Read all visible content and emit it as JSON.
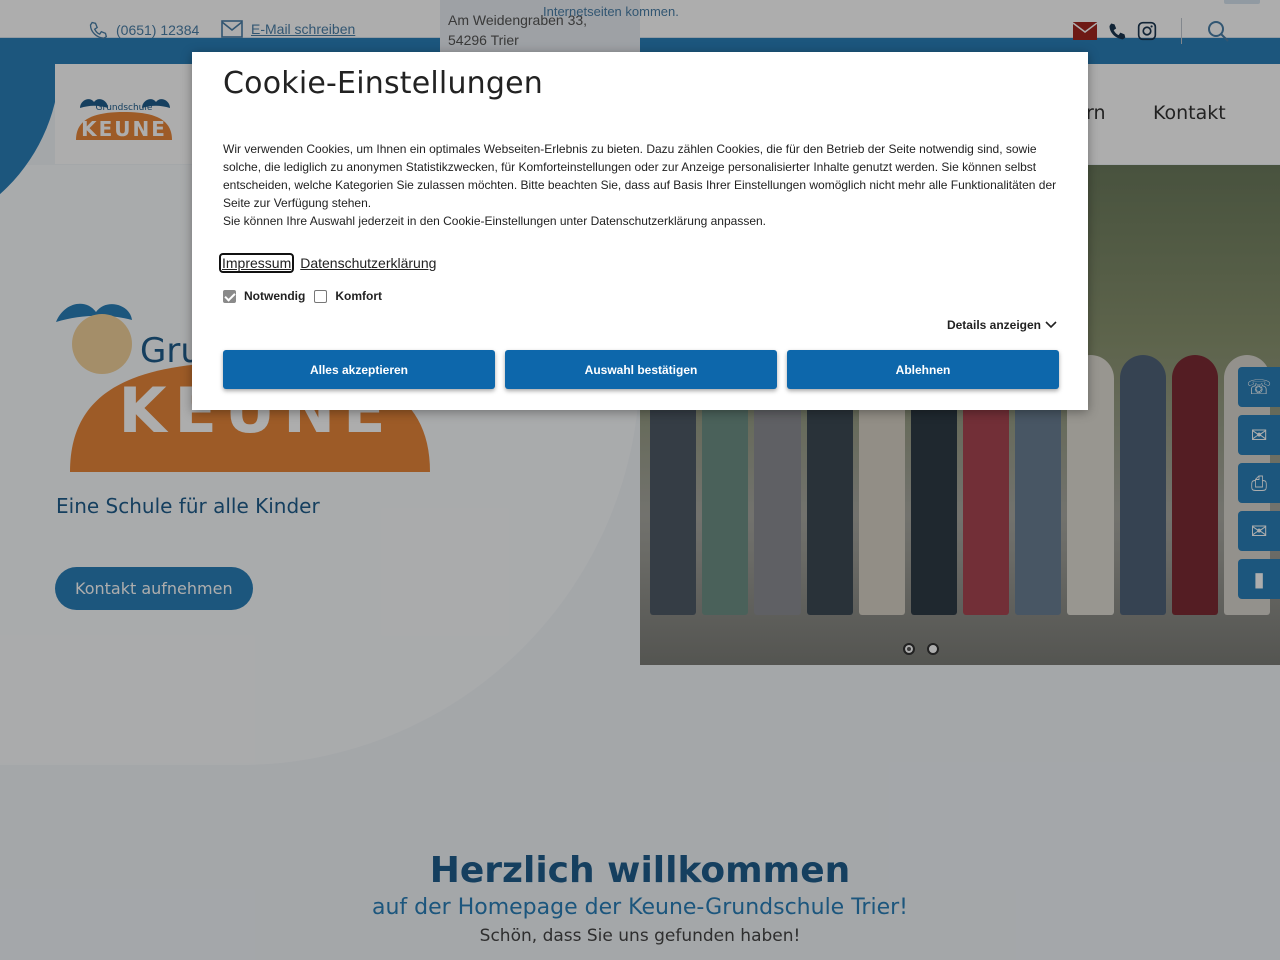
{
  "colors": {
    "accent": "#2a7fb8",
    "dark_blue": "#1f5d8c",
    "button_blue": "#0d67ab",
    "orange": "#e8873a",
    "overlay": "rgba(0,0,0,0.32)"
  },
  "topbar": {
    "phone": "(0651) 12384",
    "email_link": "E-Mail schreiben",
    "address_line1": "Am Weidengraben 33,",
    "address_line2": "54296 Trier",
    "notice_fragment": "Internetseiten kommen.",
    "icons": [
      "mail-icon",
      "phone-icon",
      "instagram-icon",
      "search-icon"
    ]
  },
  "logo": {
    "small_text": "Grundschule",
    "name": "KEUNE"
  },
  "nav": {
    "items": [
      "rn",
      "Kontakt"
    ]
  },
  "hero": {
    "logo_partial": "Gru",
    "logo_name": "KEUNE",
    "tagline": "Eine Schule für alle Kinder",
    "cta": "Kontakt aufnehmen",
    "slider_dots": 2,
    "active_dot": 1
  },
  "side_tools": [
    "contact-card-icon",
    "mail-card-icon",
    "printer-icon",
    "envelope-icon",
    "bookmark-icon"
  ],
  "welcome": {
    "title": "Herzlich willkommen",
    "subtitle": "auf der Homepage der Keune-Grundschule Trier!",
    "small": "Schön, dass Sie uns gefunden haben!"
  },
  "cookie_dialog": {
    "title": "Cookie-Einstellungen",
    "text_paragraph1": "Wir verwenden Cookies, um Ihnen ein optimales Webseiten-Erlebnis zu bieten. Dazu zählen Cookies, die für den Betrieb der Seite notwendig sind, sowie solche, die lediglich zu anonymen Statistikzwecken, für Komforteinstellungen oder zur Anzeige personalisierter Inhalte genutzt werden. Sie können selbst entscheiden, welche Kategorien Sie zulassen möchten. Bitte beachten Sie, dass auf Basis Ihrer Einstellungen womöglich nicht mehr alle Funktionalitäten der Seite zur Verfügung stehen.",
    "text_paragraph2": "Sie können Ihre Auswahl jederzeit in den Cookie-Einstellungen unter Datenschutzerklärung anpassen.",
    "links": {
      "impressum": "Impressum",
      "datenschutz": "Datenschutzerklärung"
    },
    "checkboxes": [
      {
        "label": "Notwendig",
        "checked": true,
        "disabled": true
      },
      {
        "label": "Komfort",
        "checked": false,
        "disabled": false
      }
    ],
    "details_toggle": "Details anzeigen",
    "buttons": {
      "accept_all": "Alles akzeptieren",
      "confirm": "Auswahl bestätigen",
      "decline": "Ablehnen"
    }
  }
}
